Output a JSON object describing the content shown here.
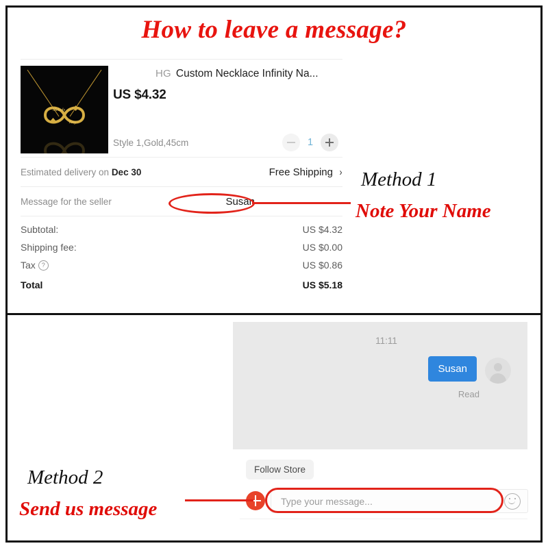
{
  "page": {
    "title": "How to leave a message?",
    "title_color": "#e8140f"
  },
  "checkout": {
    "product": {
      "store_badge": "HG",
      "title": "Custom Necklace Infinity Na...",
      "price": "US $4.32",
      "variant": "Style 1,Gold,45cm",
      "thumbnail_alt": "gold-infinity-name-necklace-on-black"
    },
    "quantity": {
      "value": "1",
      "decrease_label": "−",
      "increase_label": "+"
    },
    "delivery": {
      "label_prefix": "Estimated delivery on ",
      "date": "Dec 30",
      "shipping_label": "Free Shipping",
      "chevron": "›"
    },
    "message_row": {
      "label": "Message for the seller",
      "value": "Susan"
    },
    "totals": [
      {
        "label": "Subtotal:",
        "value": "US $4.32",
        "help": false,
        "grand": false
      },
      {
        "label": "Shipping fee:",
        "value": "US $0.00",
        "help": false,
        "grand": false
      },
      {
        "label": "Tax",
        "value": "US $0.86",
        "help": true,
        "grand": false
      },
      {
        "label": "Total",
        "value": "US $5.18",
        "help": false,
        "grand": true
      }
    ],
    "help_glyph": "?"
  },
  "annotations": {
    "method1_title": "Method 1",
    "method1_subtitle": "Note Your Name",
    "method2_title": "Method 2",
    "method2_subtitle": "Send us message",
    "highlight_color": "#e2231a",
    "black_text_color": "#111111",
    "red_text_color": "#e00c08"
  },
  "chat": {
    "timestamp": "11:11",
    "message": "Susan",
    "status": "Read",
    "bubble_color": "#2f86de",
    "avatar_alt": "user-avatar-placeholder",
    "follow_store_label": "Follow Store",
    "composer": {
      "placeholder": "Type your message...",
      "add_button_label": "+",
      "emoji_label": "emoji"
    }
  }
}
